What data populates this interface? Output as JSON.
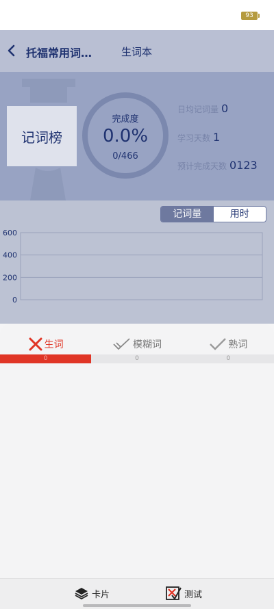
{
  "status_bar": {
    "battery": "93"
  },
  "nav": {
    "title": "托福常用词…",
    "tab": "生词本"
  },
  "hero": {
    "rank_label": "记词榜",
    "completion_label": "完成度",
    "completion_percent": "0.0%",
    "completion_count": "0/466",
    "progress_fraction": 0.0,
    "stats": [
      {
        "label": "日均记词量",
        "value": "0"
      },
      {
        "label": "学习天数",
        "value": "1"
      },
      {
        "label": "预计完成天数",
        "value": "0123"
      }
    ]
  },
  "toggle": {
    "options": [
      "记词量",
      "用时"
    ],
    "active": 0
  },
  "chart_data": {
    "type": "line",
    "x": [],
    "series": [],
    "y_ticks": [
      "600",
      "400",
      "200",
      "0"
    ],
    "ylim": [
      0,
      600
    ],
    "grid": true
  },
  "tabs": {
    "items": [
      {
        "label": "生词",
        "count": "0",
        "icon": "x-mark-icon"
      },
      {
        "label": "模糊词",
        "count": "0",
        "icon": "double-check-icon"
      },
      {
        "label": "熟词",
        "count": "0",
        "icon": "check-icon"
      }
    ],
    "active": 0
  },
  "bottom": {
    "card_label": "卡片",
    "test_label": "测试"
  },
  "colors": {
    "accent_red": "#e03526",
    "navy": "#1f3270",
    "slate": "#98a3c3"
  }
}
